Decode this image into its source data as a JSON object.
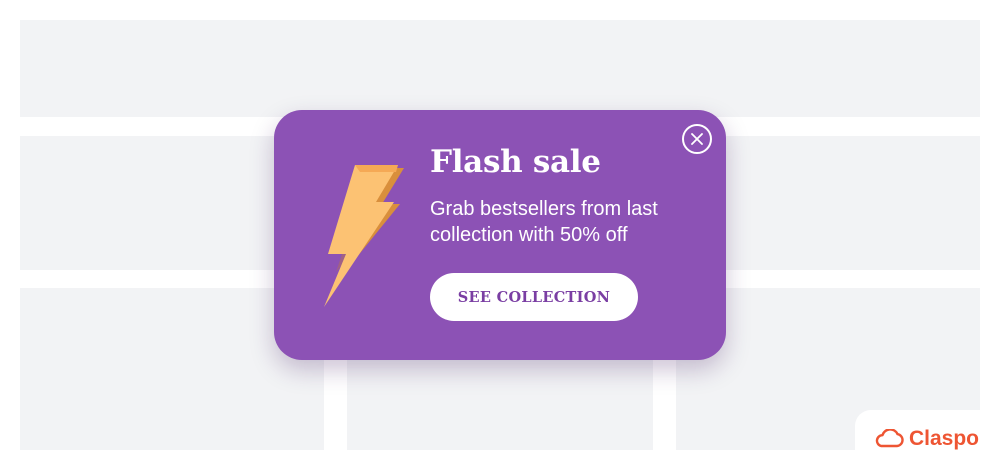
{
  "popup": {
    "title": "Flash sale",
    "description": "Grab bestsellers from last collection with 50% off",
    "cta_label": "SEE COLLECTION",
    "close_icon": "close-icon",
    "illustration_icon": "lightning-bolt-icon"
  },
  "brand": {
    "name": "Claspo",
    "logo_icon": "cloud-logo-icon"
  },
  "colors": {
    "popup_background": "#8c52b5",
    "cta_text": "#7a3ea3",
    "page_placeholder": "#f2f3f5",
    "brand_accent": "#ee5533",
    "bolt_light": "#fcc273",
    "bolt_dark": "#d98f3c"
  }
}
